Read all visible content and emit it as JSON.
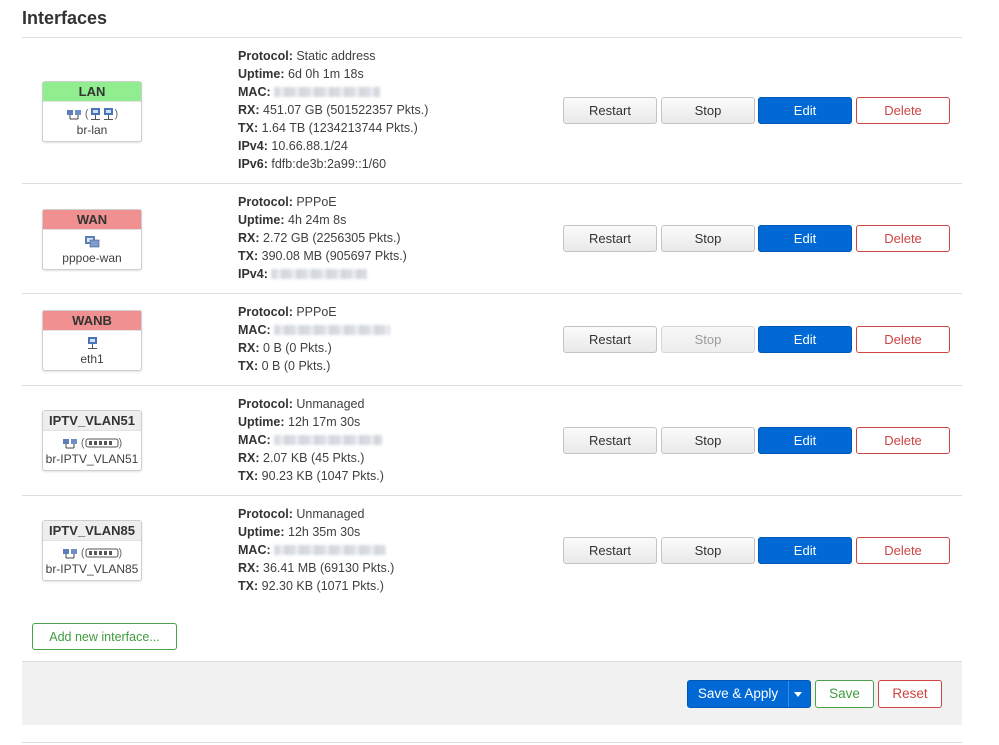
{
  "page": {
    "title": "Interfaces"
  },
  "actions": {
    "restart": "Restart",
    "stop": "Stop",
    "edit": "Edit",
    "delete": "Delete"
  },
  "labels": {
    "protocol": "Protocol:",
    "uptime": "Uptime:",
    "mac": "MAC:",
    "rx": "RX:",
    "tx": "TX:",
    "ipv4": "IPv4:",
    "ipv6": "IPv6:"
  },
  "colors": {
    "lan": "#90ee90",
    "wan": "#f09090",
    "neutral": "#eeeeee",
    "accent": "#0069d6",
    "danger": "#cc4444",
    "success": "#3f9b3f"
  },
  "interfaces": [
    {
      "name": "LAN",
      "device": "br-lan",
      "icons": "bridge-icon ( port-icon port-icon )",
      "protocol": "Static address",
      "uptime": "6d 0h 1m 18s",
      "rx": "451.07 GB (501522357 Pkts.)",
      "tx": "1.64 TB (1234213744 Pkts.)",
      "ipv4": "10.66.88.1/24",
      "ipv6": "fdfb:de3b:2a99::1/60"
    },
    {
      "name": "WAN",
      "device": "pppoe-wan",
      "icons": "tunnel-icon",
      "protocol": "PPPoE",
      "uptime": "4h 24m 8s",
      "rx": "2.72 GB (2256305 Pkts.)",
      "tx": "390.08 MB (905697 Pkts.)"
    },
    {
      "name": "WANB",
      "device": "eth1",
      "icons": "port-icon",
      "protocol": "PPPoE",
      "rx": "0 B (0 Pkts.)",
      "tx": "0 B (0 Pkts.)"
    },
    {
      "name": "IPTV_VLAN51",
      "device": "br-IPTV_VLAN51",
      "icons": "bridge-icon ( vlan-icon )",
      "protocol": "Unmanaged",
      "uptime": "12h 17m 30s",
      "rx": "2.07 KB (45 Pkts.)",
      "tx": "90.23 KB (1047 Pkts.)"
    },
    {
      "name": "IPTV_VLAN85",
      "device": "br-IPTV_VLAN85",
      "icons": "bridge-icon ( vlan-icon )",
      "protocol": "Unmanaged",
      "uptime": "12h 35m 30s",
      "rx": "36.41 MB (69130 Pkts.)",
      "tx": "92.30 KB (1071 Pkts.)"
    }
  ],
  "add_interface": "Add new interface...",
  "footer": {
    "save_apply": "Save & Apply",
    "save": "Save",
    "reset": "Reset"
  }
}
